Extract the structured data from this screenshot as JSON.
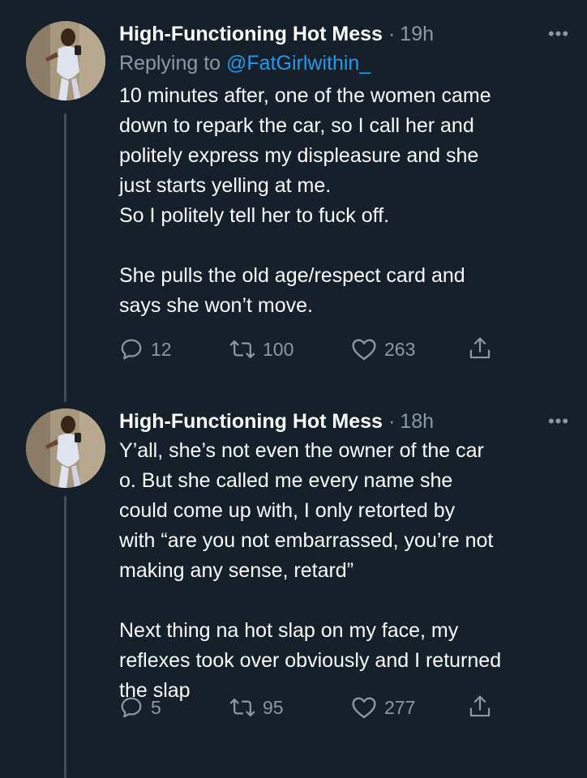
{
  "tweets": [
    {
      "author": "High-Functioning Hot Mess",
      "time": "19h",
      "reply_prefix": "Replying to ",
      "reply_handle": "@FatGirlwithin_",
      "text": "10 minutes after, one of the women came\ndown to repark the car, so I call her and\npolitely express my displeasure and she\njust starts yelling at me.\nSo I politely tell her to fuck off.\n\nShe pulls the old age/respect card and\nsays she won’t move.",
      "replies": "12",
      "retweets": "100",
      "likes": "263"
    },
    {
      "author": "High-Functioning Hot Mess",
      "time": "18h",
      "text": "Y’all, she’s not even the owner of the car\no. But she called me every name she\ncould come up with, I only retorted by\nwith “are you not embarrassed, you’re not\nmaking any sense, retard”\n\nNext thing na hot slap on my face, my\nreflexes took over obviously and I returned\nthe slap",
      "replies": "5",
      "retweets": "95",
      "likes": "277"
    }
  ],
  "ui": {
    "separator": "·",
    "more": "•••"
  }
}
